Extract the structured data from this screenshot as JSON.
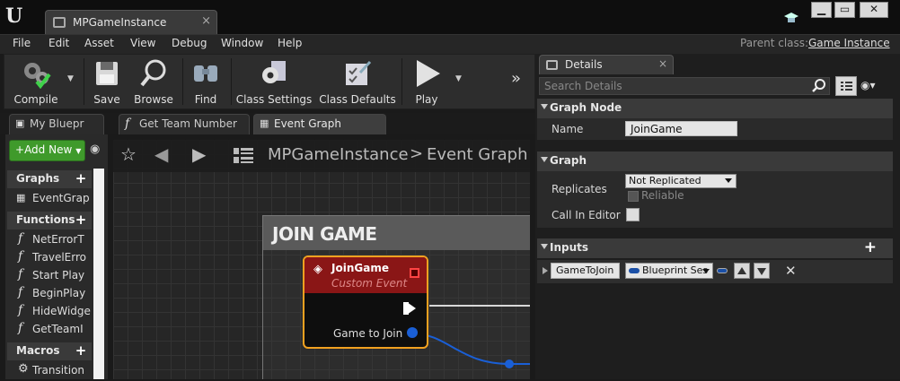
{
  "window": {
    "tab_title": "MPGameInstance",
    "tab_close": "×"
  },
  "menu": [
    "File",
    "Edit",
    "Asset",
    "View",
    "Debug",
    "Window",
    "Help"
  ],
  "parent_class": {
    "label": "Parent class:",
    "value": "Game Instance"
  },
  "toolbar": {
    "compile": "Compile",
    "save": "Save",
    "browse": "Browse",
    "find": "Find",
    "class_settings": "Class Settings",
    "class_defaults": "Class Defaults",
    "play": "Play"
  },
  "panel_tabs": [
    {
      "label": "My Bluepr"
    },
    {
      "label": "Get Team Number"
    },
    {
      "label": "Event Graph"
    }
  ],
  "my_blueprint": {
    "add_new": "Add New",
    "graphs_header": "Graphs",
    "graphs": [
      "EventGrap"
    ],
    "functions_header": "Functions",
    "functions": [
      "NetErrorT",
      "TravelErro",
      "Start Play",
      "BeginPlay",
      "HideWidge",
      "GetTeamI"
    ],
    "macros_header": "Macros",
    "macros": [
      "Transition"
    ]
  },
  "graph": {
    "breadcrumb_root": "MPGameInstance",
    "breadcrumb_sep": ">",
    "breadcrumb_leaf": "Event Graph",
    "comment_title": "JOIN GAME",
    "node": {
      "title": "JoinGame",
      "subtitle": "Custom Event",
      "pin_label": "Game to Join"
    }
  },
  "details": {
    "tab_label": "Details",
    "search_placeholder": "Search Details",
    "graph_node_section": "Graph Node",
    "name_label": "Name",
    "name_value": "JoinGame",
    "graph_section": "Graph",
    "replicates_label": "Replicates",
    "replicates_value": "Not Replicated",
    "reliable_label": "Reliable",
    "call_in_editor_label": "Call In Editor",
    "inputs_section": "Inputs",
    "input_name": "GameToJoin",
    "input_type": "Blueprint Ses"
  },
  "colors": {
    "accent_green": "#3f9a2b",
    "node_border": "#f2a120",
    "node_header": "#8a1616",
    "pin_blue": "#1a5fd6"
  }
}
